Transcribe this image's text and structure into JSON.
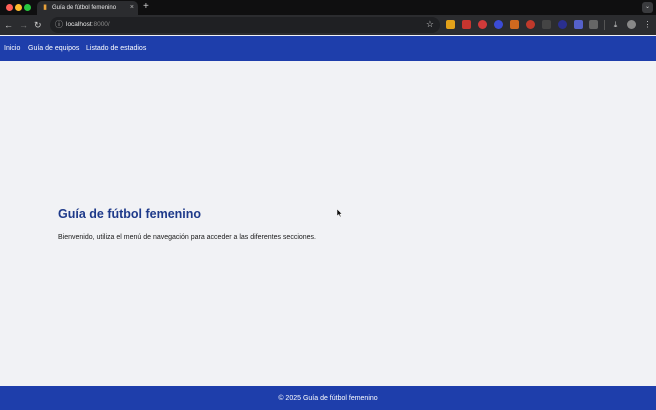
{
  "browser": {
    "tab_title": "Guía de fútbol femenino",
    "tab_favicon": "chart-favicon",
    "tab_close": "×",
    "new_tab": "+",
    "tab_menu": "⌄",
    "url_host": "localhost",
    "url_port": ":8000/",
    "back_icon": "←",
    "forward_icon": "→",
    "reload_icon": "↻",
    "info_icon": "ⓘ",
    "bookmark_icon": "☆"
  },
  "nav": {
    "items": [
      {
        "label": "Inicio"
      },
      {
        "label": "Guía de equipos"
      },
      {
        "label": "Listado de estadios"
      }
    ]
  },
  "main": {
    "title": "Guía de fútbol femenino",
    "text": "Bienvenido, utiliza el menú de navegación para acceder a las diferentes secciones."
  },
  "footer": {
    "text": "© 2025 Guía de fútbol femenino"
  },
  "colors": {
    "brand": "#1e3eab",
    "title": "#1e3a8a",
    "background": "#f1f2f5"
  }
}
